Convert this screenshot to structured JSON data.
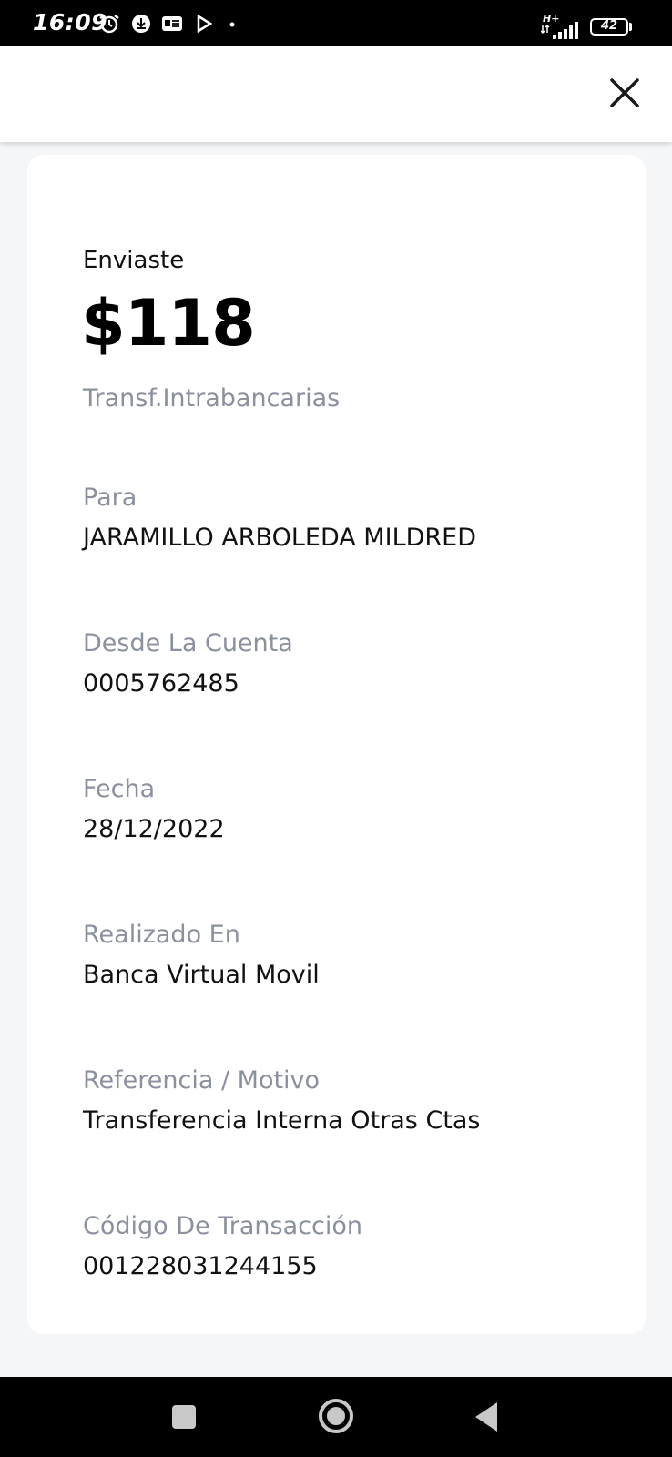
{
  "status_bar": {
    "time": "16:09",
    "network": "H+",
    "battery": "42"
  },
  "receipt": {
    "intro": "Enviaste",
    "amount": "$118",
    "type": "Transf.Intrabancarias",
    "fields": [
      {
        "label": "Para",
        "value": "JARAMILLO ARBOLEDA MILDRED"
      },
      {
        "label": "Desde La Cuenta",
        "value": "0005762485"
      },
      {
        "label": "Fecha",
        "value": "28/12/2022"
      },
      {
        "label": "Realizado En",
        "value": "Banca Virtual Movil"
      },
      {
        "label": "Referencia / Motivo",
        "value": "Transferencia Interna Otras Ctas"
      },
      {
        "label": "Código De Transacción",
        "value": "001228031244155"
      }
    ]
  },
  "icons": {
    "close": "close-icon",
    "nav": [
      "recents-icon",
      "home-icon",
      "back-icon"
    ]
  },
  "colors": {
    "background": "#f5f6f8",
    "card": "#ffffff",
    "label": "#8a909e",
    "text": "#111111"
  }
}
